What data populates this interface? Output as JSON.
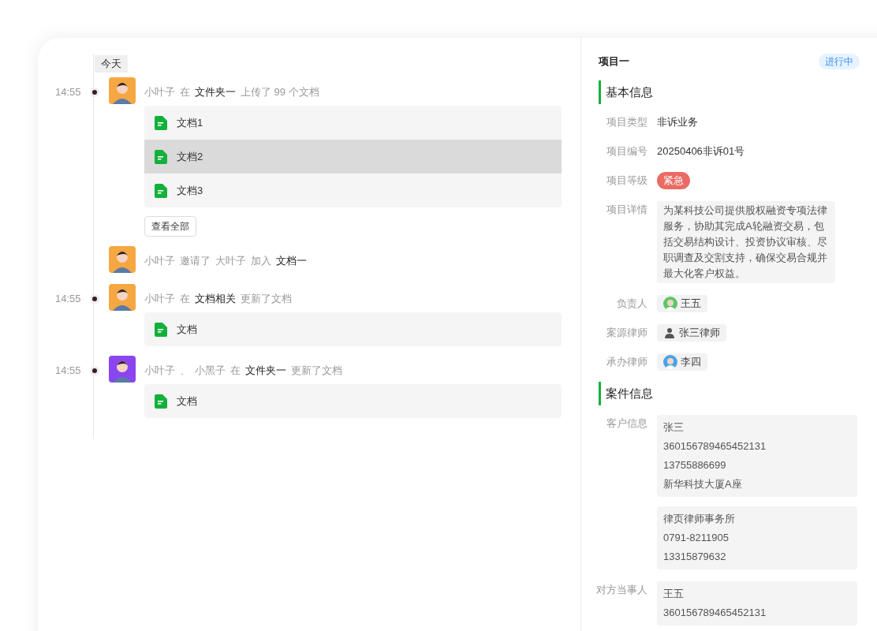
{
  "timeline": {
    "day_label": "今天",
    "events": [
      {
        "time": "14:55",
        "color": "#f5a742",
        "parts": [
          {
            "text": "小叶子",
            "strong": false
          },
          {
            "text": "在",
            "strong": false
          },
          {
            "text": "文件夹一",
            "strong": true
          },
          {
            "text": "上传了 99 个文档",
            "strong": false
          }
        ],
        "files": [
          {
            "name": "文档1",
            "highlighted": false
          },
          {
            "name": "文档2",
            "highlighted": true
          },
          {
            "name": "文档3",
            "highlighted": false
          }
        ],
        "more_button": "查看全部"
      },
      {
        "color": "#f5a742",
        "parts": [
          {
            "text": "小叶子",
            "strong": false
          },
          {
            "text": "邀请了",
            "strong": false
          },
          {
            "text": "大叶子",
            "strong": false
          },
          {
            "text": "加入",
            "strong": false
          },
          {
            "text": "文档一",
            "strong": true
          }
        ]
      },
      {
        "time": "14:55",
        "color": "#f5a742",
        "parts": [
          {
            "text": "小叶子",
            "strong": false
          },
          {
            "text": "在",
            "strong": false
          },
          {
            "text": "文档相关",
            "strong": true
          },
          {
            "text": "更新了文档",
            "strong": false
          }
        ],
        "files": [
          {
            "name": "文档",
            "highlighted": false
          }
        ]
      },
      {
        "time": "14:55",
        "color": "#8b45f0",
        "parts": [
          {
            "text": "小叶子",
            "strong": false
          },
          {
            "text": "、",
            "strong": false
          },
          {
            "text": "小黑子",
            "strong": false
          },
          {
            "text": "在",
            "strong": false
          },
          {
            "text": "文件夹一",
            "strong": true
          },
          {
            "text": "更新了文档",
            "strong": false
          }
        ],
        "files": [
          {
            "name": "文档",
            "highlighted": false
          }
        ]
      }
    ]
  },
  "detail": {
    "title": "项目一",
    "status": "进行中",
    "sections": [
      {
        "heading": "基本信息",
        "fields": [
          {
            "kind": "text",
            "label": "项目类型",
            "value": "非诉业务"
          },
          {
            "kind": "text",
            "label": "项目编号",
            "value": "20250406非诉01号"
          },
          {
            "kind": "tag",
            "label": "项目等级",
            "value": "紧急",
            "color": "#eb6a63"
          },
          {
            "kind": "note",
            "label": "项目详情",
            "value": "为某科技公司提供股权融资专项法律服务，协助其完成A轮融资交易，包括交易结构设计、投资协议审核、尽职调查及交割支持，确保交易合规并最大化客户权益。"
          },
          {
            "kind": "person",
            "label": "负责人",
            "value": "王五",
            "color": "#5cc66b"
          },
          {
            "kind": "person",
            "label": "案源律师",
            "value": "张三律师"
          },
          {
            "kind": "person",
            "label": "承办律师",
            "value": "李四",
            "color": "#4aa3e8"
          }
        ]
      },
      {
        "heading": "案件信息",
        "fields": [
          {
            "kind": "cards",
            "label": "客户信息",
            "cards": [
              [
                "张三",
                "360156789465452131",
                "13755886699",
                "新华科技大厦A座"
              ],
              [
                "律页律师事务所",
                "0791-8211905",
                "13315879632"
              ]
            ]
          },
          {
            "kind": "cards",
            "label": "对方当事人",
            "cards": [
              [
                "王五",
                "360156789465452131"
              ]
            ]
          }
        ]
      }
    ]
  }
}
